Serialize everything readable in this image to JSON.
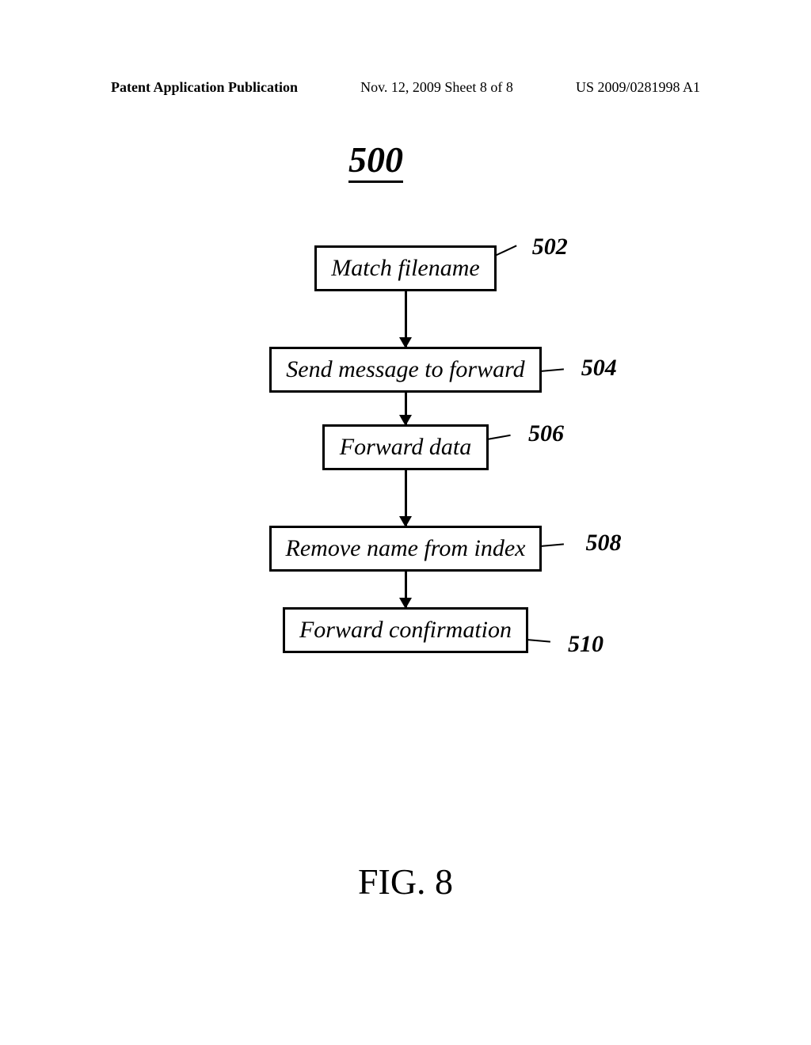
{
  "header": {
    "left": "Patent Application Publication",
    "mid": "Nov. 12, 2009  Sheet 8 of 8",
    "right": "US 2009/0281998 A1"
  },
  "diagram": {
    "overall_ref": "500",
    "figure_label": "FIG. 8",
    "nodes": [
      {
        "text": "Match filename",
        "ref": "502"
      },
      {
        "text": "Send message to forward",
        "ref": "504"
      },
      {
        "text": "Forward data",
        "ref": "506"
      },
      {
        "text": "Remove name from index",
        "ref": "508"
      },
      {
        "text": "Forward confirmation",
        "ref": "510"
      }
    ]
  },
  "chart_data": {
    "type": "flowchart",
    "title": "FIG. 8",
    "overall_ref": "500",
    "steps": [
      {
        "id": "502",
        "label": "Match filename"
      },
      {
        "id": "504",
        "label": "Send message to forward"
      },
      {
        "id": "506",
        "label": "Forward data"
      },
      {
        "id": "508",
        "label": "Remove name from index"
      },
      {
        "id": "510",
        "label": "Forward confirmation"
      }
    ],
    "edges": [
      {
        "from": "502",
        "to": "504"
      },
      {
        "from": "504",
        "to": "506"
      },
      {
        "from": "506",
        "to": "508"
      },
      {
        "from": "508",
        "to": "510"
      }
    ]
  }
}
